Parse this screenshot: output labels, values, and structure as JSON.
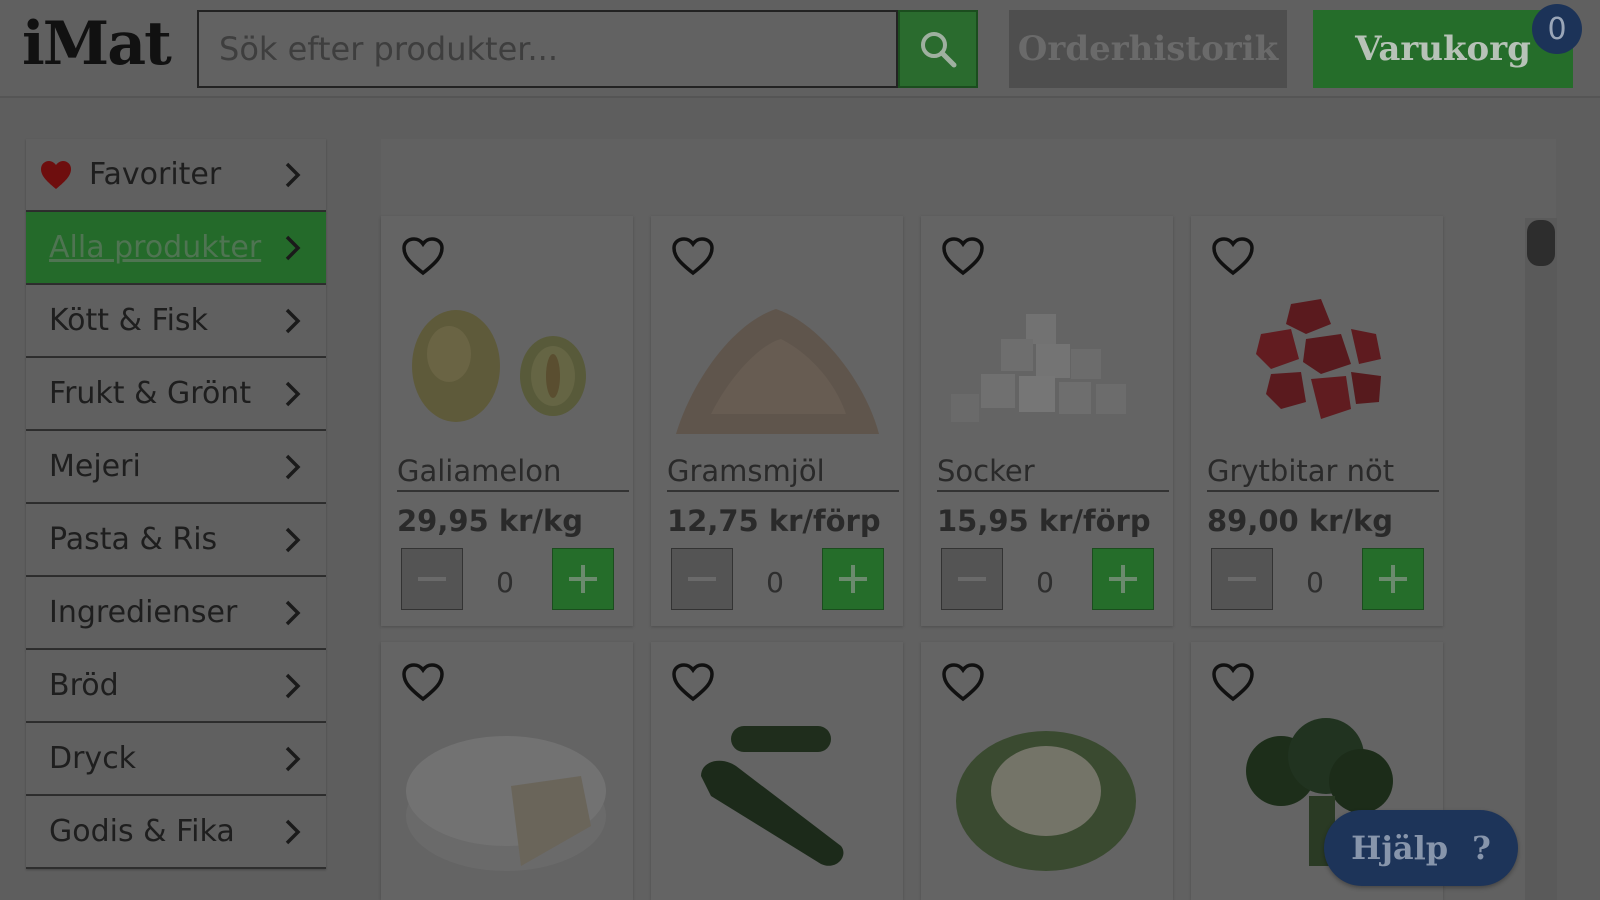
{
  "header": {
    "logo": "iMat",
    "search_placeholder": "Sök efter produkter...",
    "search_icon": "search-icon",
    "order_history": "Orderhistorik",
    "cart": "Varukorg",
    "cart_count": "0"
  },
  "sidebar": {
    "items": [
      {
        "label": "Favoriter",
        "icon": "heart-icon"
      },
      {
        "label": "Alla produkter"
      },
      {
        "label": "Kött & Fisk"
      },
      {
        "label": "Frukt & Grönt"
      },
      {
        "label": "Mejeri"
      },
      {
        "label": "Pasta & Ris"
      },
      {
        "label": "Ingredienser"
      },
      {
        "label": "Bröd"
      },
      {
        "label": "Dryck"
      },
      {
        "label": "Godis & Fika"
      }
    ]
  },
  "products": [
    {
      "name": "Galiamelon",
      "price": "29,95 kr/kg",
      "qty": "0"
    },
    {
      "name": "Gramsmjöl",
      "price": "12,75 kr/förp",
      "qty": "0"
    },
    {
      "name": "Socker",
      "price": "15,95 kr/förp",
      "qty": "0"
    },
    {
      "name": "Grytbitar nöt",
      "price": "89,00 kr/kg",
      "qty": "0"
    }
  ],
  "help": {
    "label": "Hjälp",
    "icon": "?"
  },
  "colors": {
    "accent_green": "#256d2a",
    "overlay_gray": "#606060",
    "navy": "#1c3358"
  }
}
